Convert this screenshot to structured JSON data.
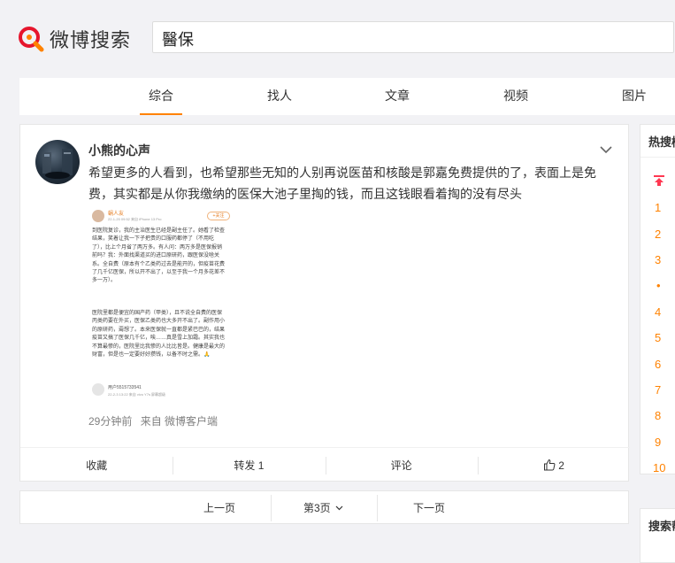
{
  "header": {
    "logo_text": "微博搜索",
    "search_value": "醫保"
  },
  "tabs": [
    {
      "label": "综合",
      "active": true
    },
    {
      "label": "找人",
      "active": false
    },
    {
      "label": "文章",
      "active": false
    },
    {
      "label": "视频",
      "active": false
    },
    {
      "label": "图片",
      "active": false
    }
  ],
  "post": {
    "author": "小熊的心声",
    "text": "希望更多的人看到，也希望那些无知的人别再说医苗和核酸是郭嘉免费提供的了，表面上是免费，其实都是从你我缴纳的医保大池子里掏的钱，而且这钱眼看着掏的没有尽头",
    "image": {
      "user": "蜗人友",
      "sub": "22-1-20 09:52 来自 iPhone 13 Pro",
      "follow": "+关注",
      "para1": "到医院复诊，我的主治医生已经是副主任了。她看了检查结果，笑着让我一下子把贵的口服药都停了（不用吃了），比上个月省了两万多。有人问：两万多是医保报销前吗？我：外面找渠道买的进口原研药，跟医保没啥关系。全自费（原本有个乙类药过去是能开的，但疫苗花费了几千亿医保，所以开不出了，以至于我一个月多花差不多一万）。",
      "para2": "医院里都是便宜的国产药（甲类），且不说全自费的医保丙类药要在外买，医保乙类药也大多开不出了。副作用小的原研药，甭想了。本来医保就一直都是紧巴巴的，结果疫苗又搞了医保几千亿，唉……真是雪上加霜。其实我也不算最惨的，医院里比我惨的人比比皆是。健康是最大的财富，但是也一定要好好攒钱，以备不时之需。🙏",
      "footer_user": "用户5515733541",
      "footer_sub": "22-2-3 13:22 来自 vivo Y7s 屏幕超级"
    },
    "time": "29分钟前",
    "source": "来自 微博客户端"
  },
  "actions": {
    "collect": "收藏",
    "repost": "转发 1",
    "comment": "评论",
    "like_count": "2"
  },
  "pager": {
    "prev": "上一页",
    "current": "第3页",
    "next": "下一页"
  },
  "sidebar": {
    "hot_title": "热搜榜",
    "ranks": [
      "1",
      "2",
      "3",
      "•",
      "4",
      "5",
      "6",
      "7",
      "8",
      "9",
      "10"
    ],
    "search_title": "搜索帮助"
  },
  "colors": {
    "accent": "#ff8200",
    "background": "#f2f2f5",
    "logo_red": "#e6162d"
  }
}
